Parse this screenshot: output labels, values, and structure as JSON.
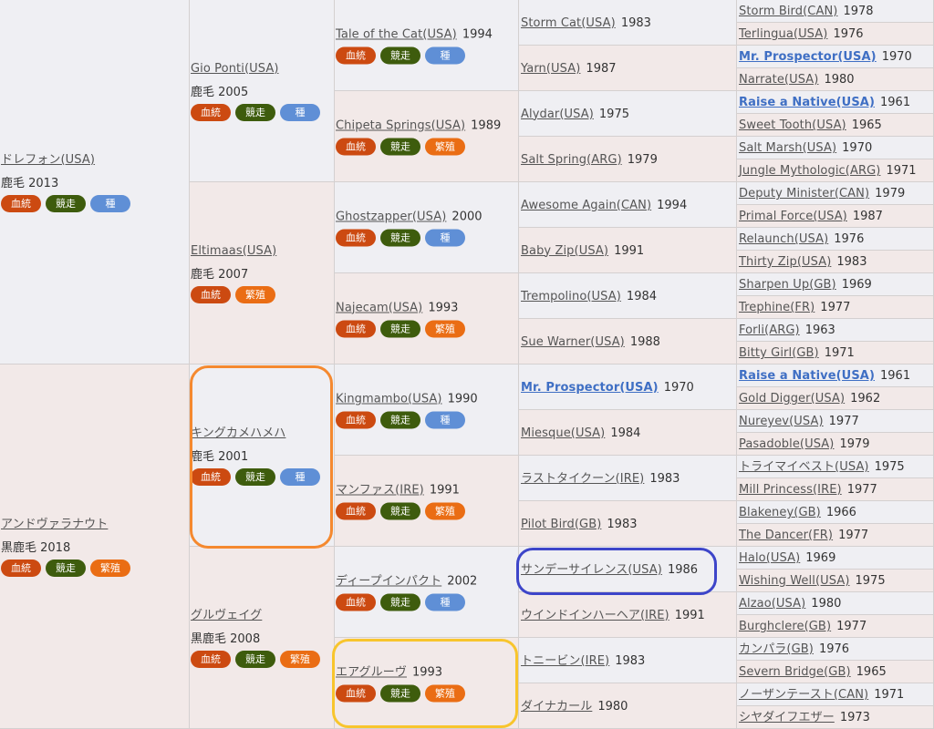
{
  "badge_labels": {
    "kettou": "血統",
    "kyoso": "競走",
    "shu": "種",
    "hanshoku": "繁殖"
  },
  "colors": {
    "sire_bg": "#efeff3",
    "dam_bg": "#f2e9e8",
    "link": "#555555",
    "bold_link": "#3f6fc4",
    "ring_orange": "#f5892f",
    "ring_blue": "#3d45c9",
    "ring_yellow": "#f8c52d"
  },
  "gen1": [
    {
      "name": "ドレフォン(USA)",
      "coat": "鹿毛 2013",
      "badges": [
        "kettou",
        "kyoso",
        "shu"
      ]
    },
    {
      "name": "アンドヴァラナウト",
      "coat": "黒鹿毛 2018",
      "badges": [
        "kettou",
        "kyoso",
        "hanshoku"
      ]
    }
  ],
  "gen2": [
    {
      "name": "Gio Ponti(USA)",
      "coat": "鹿毛 2005",
      "badges": [
        "kettou",
        "kyoso",
        "shu"
      ]
    },
    {
      "name": "Eltimaas(USA)",
      "coat": "鹿毛 2007",
      "badges": [
        "kettou",
        "hanshoku"
      ]
    },
    {
      "name": "キングカメハメハ",
      "coat": "鹿毛 2001",
      "badges": [
        "kettou",
        "kyoso",
        "shu"
      ]
    },
    {
      "name": "グルヴェイグ",
      "coat": "黒鹿毛 2008",
      "badges": [
        "kettou",
        "kyoso",
        "hanshoku"
      ]
    }
  ],
  "gen3": [
    {
      "name": "Tale of the Cat(USA)",
      "year": "1994",
      "badges": [
        "kettou",
        "kyoso",
        "shu"
      ]
    },
    {
      "name": "Chipeta Springs(USA)",
      "year": "1989",
      "badges": [
        "kettou",
        "kyoso",
        "hanshoku"
      ]
    },
    {
      "name": "Ghostzapper(USA)",
      "year": "2000",
      "badges": [
        "kettou",
        "kyoso",
        "shu"
      ]
    },
    {
      "name": "Najecam(USA)",
      "year": "1993",
      "badges": [
        "kettou",
        "kyoso",
        "hanshoku"
      ]
    },
    {
      "name": "Kingmambo(USA)",
      "year": "1990",
      "badges": [
        "kettou",
        "kyoso",
        "shu"
      ]
    },
    {
      "name": "マンファス(IRE)",
      "year": "1991",
      "badges": [
        "kettou",
        "kyoso",
        "hanshoku"
      ]
    },
    {
      "name": "ディープインパクト",
      "year": "2002",
      "badges": [
        "kettou",
        "kyoso",
        "shu"
      ]
    },
    {
      "name": "エアグルーヴ",
      "year": "1993",
      "badges": [
        "kettou",
        "kyoso",
        "hanshoku"
      ]
    }
  ],
  "gen4": [
    {
      "name": "Storm Cat(USA)",
      "year": "1983"
    },
    {
      "name": "Yarn(USA)",
      "year": "1987"
    },
    {
      "name": "Alydar(USA)",
      "year": "1975"
    },
    {
      "name": "Salt Spring(ARG)",
      "year": "1979"
    },
    {
      "name": "Awesome Again(CAN)",
      "year": "1994"
    },
    {
      "name": "Baby Zip(USA)",
      "year": "1991"
    },
    {
      "name": "Trempolino(USA)",
      "year": "1984"
    },
    {
      "name": "Sue Warner(USA)",
      "year": "1988"
    },
    {
      "name": "Mr. Prospector(USA)",
      "year": "1970",
      "bold": true
    },
    {
      "name": "Miesque(USA)",
      "year": "1984"
    },
    {
      "name": "ラストタイクーン(IRE)",
      "year": "1983"
    },
    {
      "name": "Pilot Bird(GB)",
      "year": "1983"
    },
    {
      "name": "サンデーサイレンス(USA)",
      "year": "1986"
    },
    {
      "name": "ウインドインハーヘア(IRE)",
      "year": "1991"
    },
    {
      "name": "トニービン(IRE)",
      "year": "1983"
    },
    {
      "name": "ダイナカール",
      "year": "1980"
    }
  ],
  "gen5": [
    {
      "name": "Storm Bird(CAN)",
      "year": "1978"
    },
    {
      "name": "Terlingua(USA)",
      "year": "1976"
    },
    {
      "name": "Mr. Prospector(USA)",
      "year": "1970",
      "bold": true
    },
    {
      "name": "Narrate(USA)",
      "year": "1980"
    },
    {
      "name": "Raise a Native(USA)",
      "year": "1961",
      "bold": true
    },
    {
      "name": "Sweet Tooth(USA)",
      "year": "1965"
    },
    {
      "name": "Salt Marsh(USA)",
      "year": "1970"
    },
    {
      "name": "Jungle Mythologic(ARG)",
      "year": "1971"
    },
    {
      "name": "Deputy Minister(CAN)",
      "year": "1979"
    },
    {
      "name": "Primal Force(USA)",
      "year": "1987"
    },
    {
      "name": "Relaunch(USA)",
      "year": "1976"
    },
    {
      "name": "Thirty Zip(USA)",
      "year": "1983"
    },
    {
      "name": "Sharpen Up(GB)",
      "year": "1969"
    },
    {
      "name": "Trephine(FR)",
      "year": "1977"
    },
    {
      "name": "Forli(ARG)",
      "year": "1963"
    },
    {
      "name": "Bitty Girl(GB)",
      "year": "1971"
    },
    {
      "name": "Raise a Native(USA)",
      "year": "1961",
      "bold": true
    },
    {
      "name": "Gold Digger(USA)",
      "year": "1962"
    },
    {
      "name": "Nureyev(USA)",
      "year": "1977"
    },
    {
      "name": "Pasadoble(USA)",
      "year": "1979"
    },
    {
      "name": "トライマイベスト(USA)",
      "year": "1975"
    },
    {
      "name": "Mill Princess(IRE)",
      "year": "1977"
    },
    {
      "name": "Blakeney(GB)",
      "year": "1966"
    },
    {
      "name": "The Dancer(FR)",
      "year": "1977"
    },
    {
      "name": "Halo(USA)",
      "year": "1969"
    },
    {
      "name": "Wishing Well(USA)",
      "year": "1975"
    },
    {
      "name": "Alzao(USA)",
      "year": "1980"
    },
    {
      "name": "Burghclere(GB)",
      "year": "1977"
    },
    {
      "name": "カンパラ(GB)",
      "year": "1976"
    },
    {
      "name": "Severn Bridge(GB)",
      "year": "1965"
    },
    {
      "name": "ノーザンテースト(CAN)",
      "year": "1971"
    },
    {
      "name": "シヤダイフエザー",
      "year": "1973"
    }
  ],
  "highlights": [
    {
      "label": "king-kamehameha",
      "color": "#f5892f"
    },
    {
      "label": "sunday-silence",
      "color": "#3d45c9"
    },
    {
      "label": "air-groove",
      "color": "#f8c52d"
    }
  ]
}
